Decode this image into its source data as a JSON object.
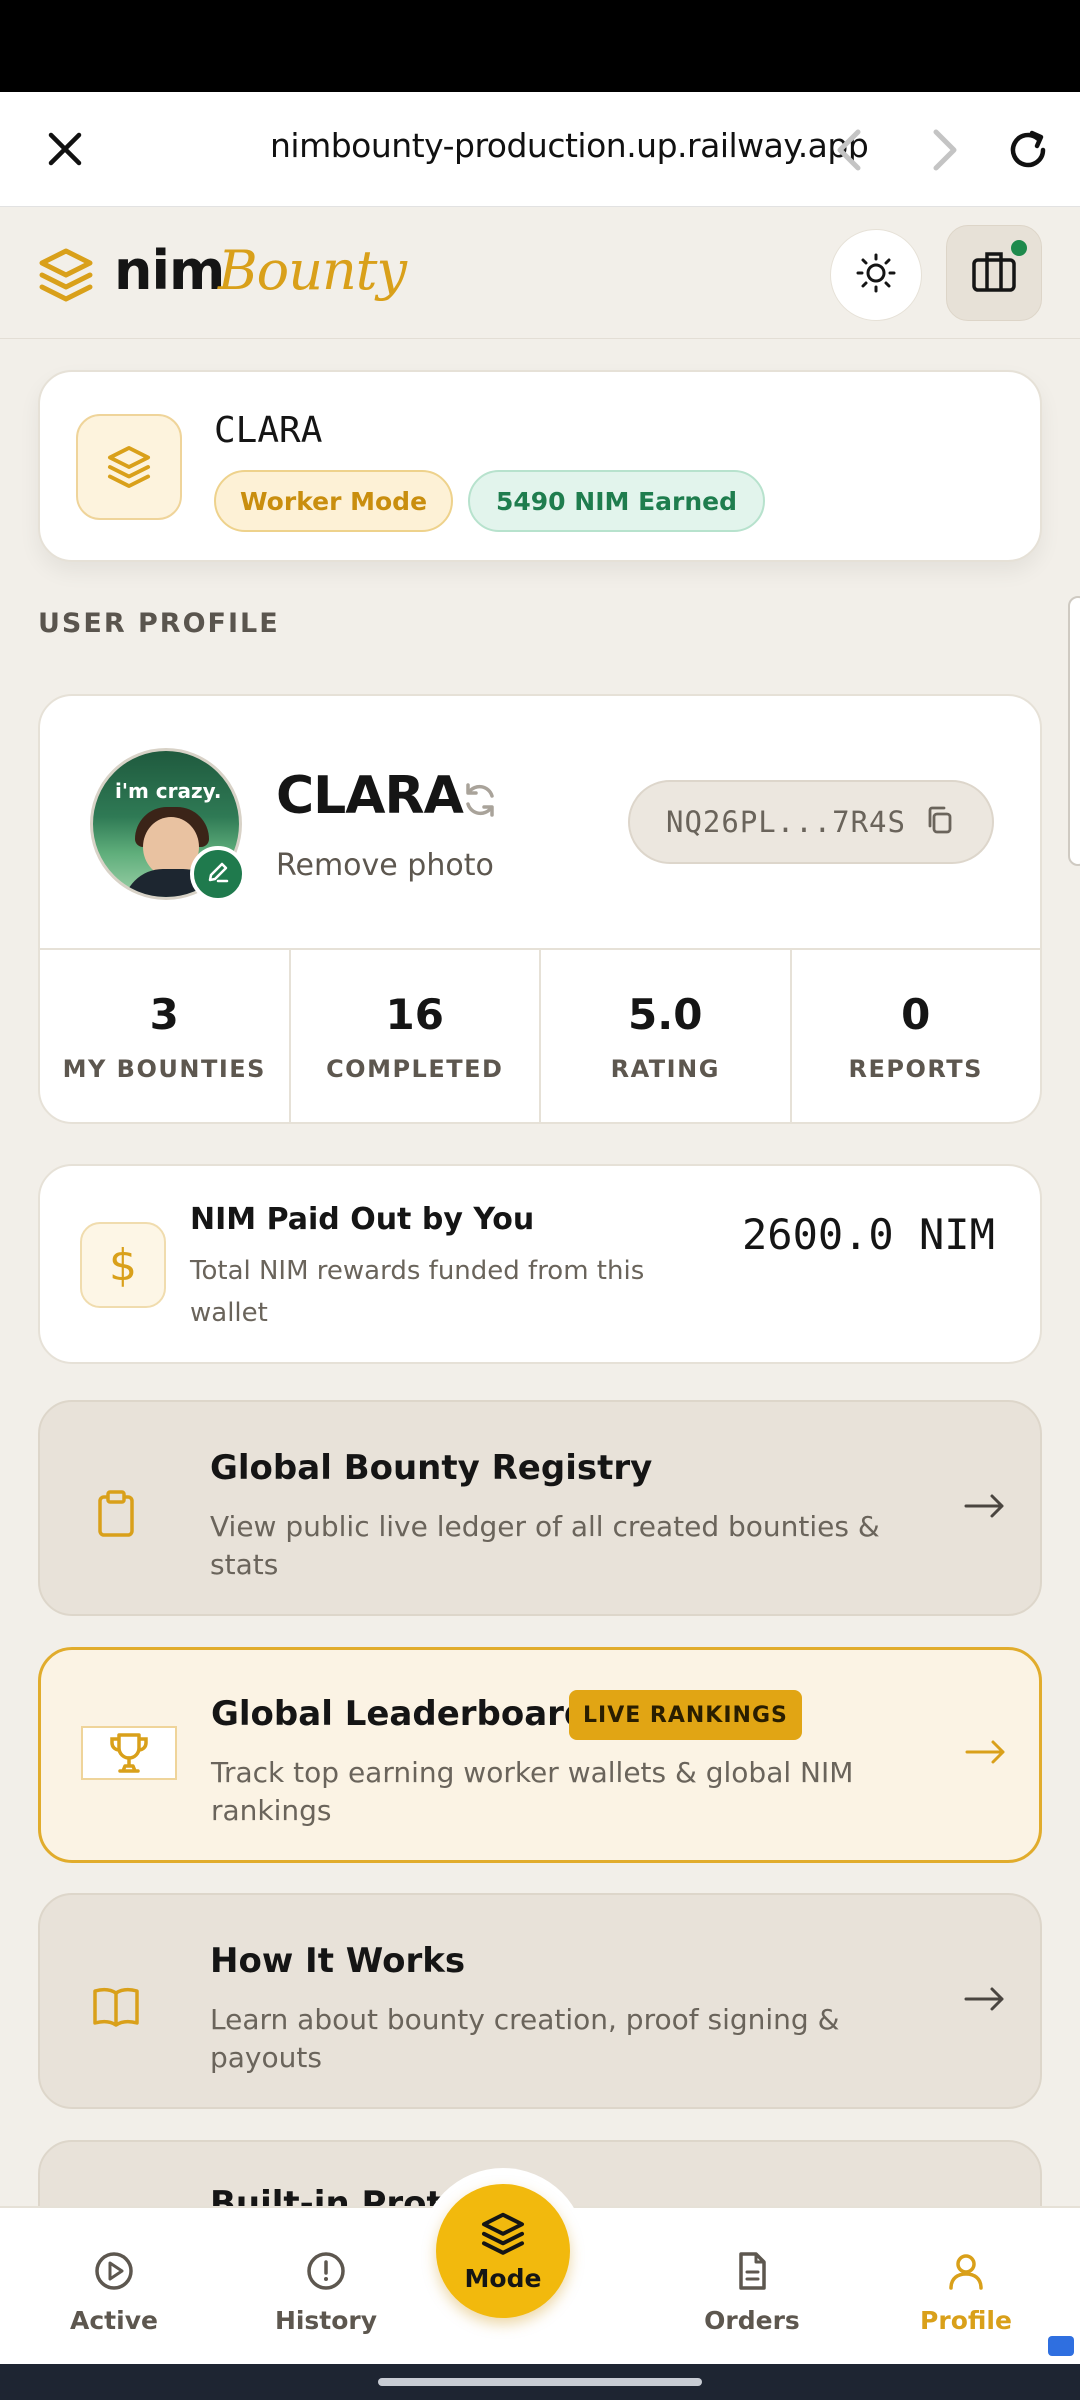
{
  "browser": {
    "url": "nimbounty-production.up.railway.app"
  },
  "header": {
    "logo_nim": "nim",
    "logo_bounty": "Bounty"
  },
  "mode_card": {
    "name": "CLARA",
    "mode_badge": "Worker Mode",
    "earned_badge": "5490 NIM Earned"
  },
  "section_title": "USER PROFILE",
  "profile": {
    "name": "CLARA",
    "remove_photo": "Remove photo",
    "address": "NQ26PL...7R4S",
    "avatar_text": "i'm crazy.",
    "stats": [
      {
        "value": "3",
        "label": "MY BOUNTIES"
      },
      {
        "value": "16",
        "label": "COMPLETED"
      },
      {
        "value": "5.0",
        "label": "RATING"
      },
      {
        "value": "0",
        "label": "REPORTS"
      }
    ]
  },
  "paid_out": {
    "title": "NIM Paid Out by You",
    "description": "Total NIM rewards funded from this wallet",
    "amount": "2600.0 NIM"
  },
  "links": [
    {
      "title": "Global Bounty Registry",
      "description": "View public live ledger of all created bounties & stats"
    },
    {
      "title": "Global Leaderboard",
      "badge": "LIVE RANKINGS",
      "description": "Track top earning worker wallets & global NIM rankings"
    },
    {
      "title": "How It Works",
      "description": "Learn about bounty creation, proof signing & payouts"
    },
    {
      "title": "Built-in Proto"
    }
  ],
  "bottom_nav": {
    "items": [
      {
        "label": "Active"
      },
      {
        "label": "History"
      },
      {
        "label": "Mode"
      },
      {
        "label": "Orders"
      },
      {
        "label": "Profile"
      }
    ],
    "active": "Profile"
  },
  "colors": {
    "accent": "#d9a01a",
    "success": "#1f7d4e",
    "background": "#f2efe9"
  }
}
